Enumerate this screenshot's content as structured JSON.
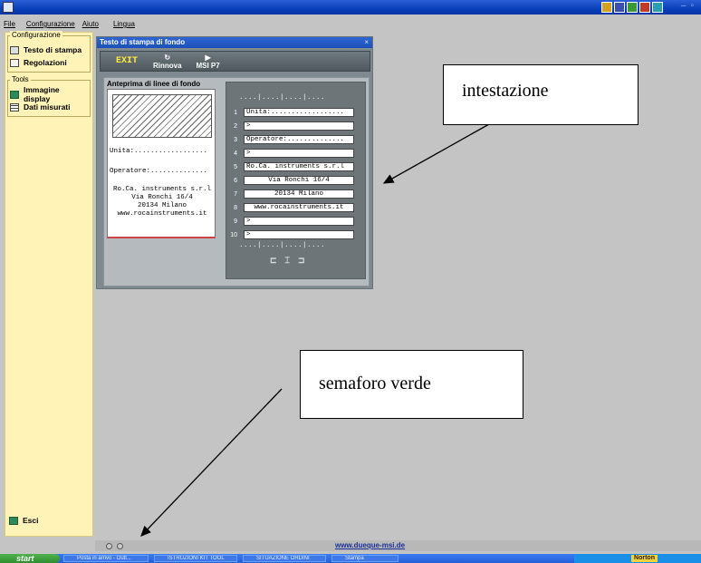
{
  "app": {
    "title": ""
  },
  "menubar": {
    "items": [
      "File",
      "Configurazione",
      "Aiuto",
      "Lingua"
    ]
  },
  "sidebar": {
    "config_group": "Configurazione",
    "config_items": [
      "Testo di stampa",
      "Regolazioni"
    ],
    "tools_group": "Tools",
    "tools_items": [
      "Immagine display",
      "Dati misurati"
    ],
    "exit_label": "Esci"
  },
  "dialog": {
    "title": "Testo di stampa di fondo",
    "toolbar": {
      "exit_label": "EXIT",
      "refresh_label": "Rinnova",
      "msi_label": "MSI P7"
    },
    "preview_title": "Anteprima di linee di fondo",
    "preview_lines": [
      "Unita:..................",
      "Operatore:..............",
      "Ro.Ca. instruments s.r.l",
      "Via Ronchi 16/4",
      "20134 Milano",
      "www.rocainstruments.it"
    ],
    "ruler": "....|....|....|....",
    "editor_lines": [
      {
        "num": "1",
        "text": "Unita:.................."
      },
      {
        "num": "2",
        "text": ">"
      },
      {
        "num": "3",
        "text": "Operatore:.............."
      },
      {
        "num": "4",
        "text": ">"
      },
      {
        "num": "5",
        "text": "Ro.Ca. instruments s.r.l"
      },
      {
        "num": "6",
        "text": "Via Ronchi 16/4"
      },
      {
        "num": "7",
        "text": "20134 Milano"
      },
      {
        "num": "8",
        "text": "www.rocainstruments.it"
      },
      {
        "num": "9",
        "text": ">"
      },
      {
        "num": "10",
        "text": ">"
      }
    ],
    "align_icons": [
      "align-left-icon",
      "align-center-icon",
      "align-right-icon"
    ]
  },
  "callouts": {
    "header": "intestazione",
    "light": "semaforo verde"
  },
  "status": {
    "link": "www.dueque-msi.de"
  },
  "taskbar": {
    "start": "start",
    "tasks": [
      "Posta in arrivo - Outl...",
      "ISTRUZIONI KIT TOOL",
      "SITUAZIONE ORDINI",
      "Stampa"
    ],
    "norton": "Norton"
  }
}
